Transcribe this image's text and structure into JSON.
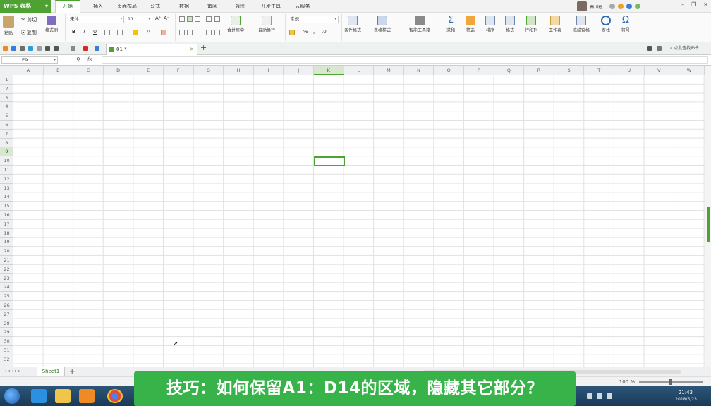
{
  "app": {
    "name": "WPS 表格",
    "accent": "#4ea232"
  },
  "menu_tabs": [
    {
      "label": "开始",
      "active": true
    },
    {
      "label": "插入",
      "active": false
    },
    {
      "label": "页面布局",
      "active": false
    },
    {
      "label": "公式",
      "active": false
    },
    {
      "label": "数据",
      "active": false
    },
    {
      "label": "审阅",
      "active": false
    },
    {
      "label": "视图",
      "active": false
    },
    {
      "label": "开发工具",
      "active": false
    },
    {
      "label": "云服务",
      "active": false
    }
  ],
  "user": {
    "name": "秦川在..."
  },
  "ribbon": {
    "paste": "粘贴",
    "cut": "剪切",
    "copy": "复制",
    "format_painter": "格式刷",
    "font_name": "宋体",
    "font_size": "11",
    "merge_center": "合并居中",
    "wrap_text": "自动换行",
    "number_format": "常规",
    "conditional_format": "条件格式",
    "table_style": "表格样式",
    "smart_toolbox": "智能工具箱",
    "sum": "求和",
    "filter": "筛选",
    "sort": "排序",
    "format": "格式",
    "row_col": "行和列",
    "worksheet": "工作表",
    "freeze_panes": "冻结窗格",
    "find": "查找",
    "symbol": "符号",
    "bold": "B",
    "italic": "I",
    "underline": "U",
    "percent": "%"
  },
  "doc_tab": {
    "label": "01 *"
  },
  "search_commands": "点此查找命令",
  "formula_bar": {
    "name_box": "E9",
    "fx": "fx"
  },
  "grid": {
    "columns": [
      "A",
      "B",
      "C",
      "D",
      "E",
      "F",
      "G",
      "H",
      "I",
      "J",
      "K",
      "L",
      "M",
      "N",
      "O",
      "P",
      "Q",
      "R",
      "S",
      "T",
      "U",
      "V",
      "W"
    ],
    "rows": [
      "1",
      "2",
      "3",
      "4",
      "5",
      "6",
      "7",
      "8",
      "9",
      "10",
      "11",
      "12",
      "13",
      "14",
      "15",
      "16",
      "17",
      "18",
      "19",
      "20",
      "21",
      "22",
      "23",
      "24",
      "25",
      "26",
      "27",
      "28",
      "29",
      "30",
      "31",
      "32"
    ],
    "selected_column": "K",
    "selected_row": "9"
  },
  "sheet_tabs": [
    {
      "label": "Sheet1",
      "active": true
    }
  ],
  "status": {
    "zoom": "100 %"
  },
  "taskbar": {
    "time": "21:43",
    "date": "2018/5/23"
  },
  "caption": "技巧：如何保留A1：D14的区域，隐藏其它部分？",
  "icons": [
    "paste-icon",
    "cut-icon",
    "copy-icon",
    "format-painter-icon",
    "sum-icon",
    "filter-icon",
    "sort-icon",
    "find-icon",
    "symbol-icon",
    "start-icon"
  ]
}
